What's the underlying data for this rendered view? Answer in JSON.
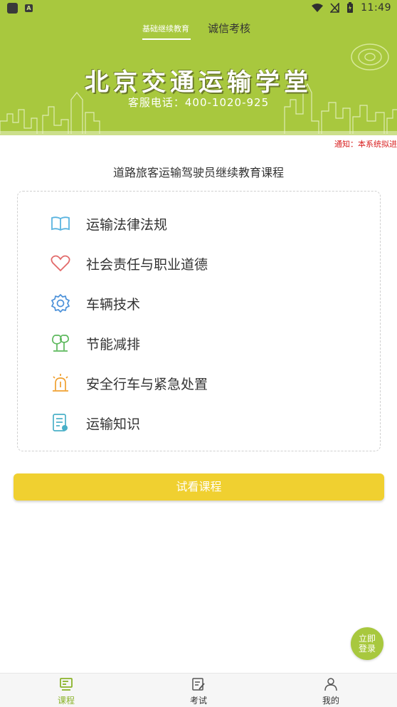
{
  "statusbar": {
    "time": "11:49"
  },
  "header": {
    "tabs": [
      {
        "label": "基础继续教育",
        "active": true
      },
      {
        "label": "诚信考核",
        "active": false
      }
    ],
    "banner_title": "北京交通运输学堂",
    "banner_phone": "客服电话：400-1020-925",
    "background_color": "#a8c83e"
  },
  "notice": "通知：本系统拟进",
  "course_section": {
    "title": "道路旅客运输驾驶员继续教育课程",
    "items": [
      {
        "label": "运输法律法规",
        "icon": "book-icon"
      },
      {
        "label": "社会责任与职业道德",
        "icon": "heart-icon"
      },
      {
        "label": "车辆技术",
        "icon": "gear-icon"
      },
      {
        "label": "节能减排",
        "icon": "tree-icon"
      },
      {
        "label": "安全行车与紧急处置",
        "icon": "alarm-light-icon"
      },
      {
        "label": "运输知识",
        "icon": "document-icon"
      }
    ]
  },
  "trial_button": "试看课程",
  "login_fab": {
    "line1": "立即",
    "line2": "登录"
  },
  "bottom_nav": [
    {
      "label": "课程",
      "icon": "course-icon",
      "active": true
    },
    {
      "label": "考试",
      "icon": "exam-icon",
      "active": false
    },
    {
      "label": "我的",
      "icon": "profile-icon",
      "active": false
    }
  ],
  "colors": {
    "accent": "#a8c83e",
    "button": "#f0d030",
    "notice": "#d81e1e"
  }
}
